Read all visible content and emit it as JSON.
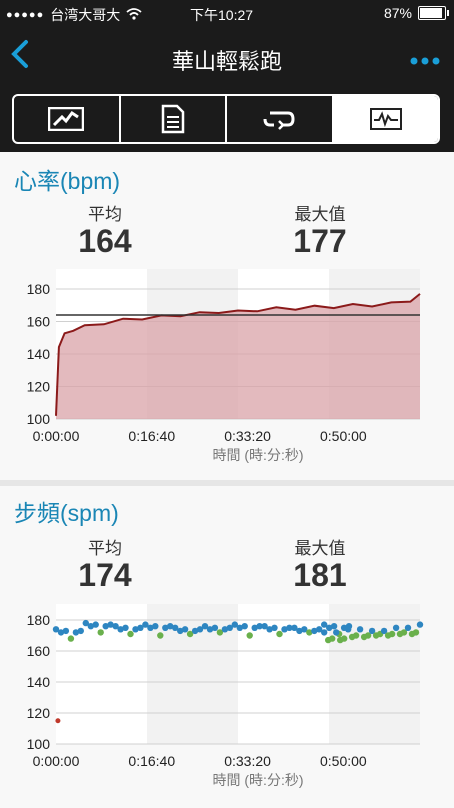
{
  "status": {
    "carrier": "台湾大哥大",
    "time": "下午10:27",
    "battery": "87%"
  },
  "nav": {
    "title": "華山輕鬆跑"
  },
  "tabs": [
    {
      "icon": "map-icon"
    },
    {
      "icon": "document-icon"
    },
    {
      "icon": "repeat-icon"
    },
    {
      "icon": "chart-icon",
      "selected": true
    }
  ],
  "hr": {
    "title": "心率(bpm)",
    "avg_label": "平均",
    "avg": "164",
    "max_label": "最大值",
    "max": "177"
  },
  "cad": {
    "title": "步頻(spm)",
    "avg_label": "平均",
    "avg": "174",
    "max_label": "最大值",
    "max": "181"
  },
  "colors": {
    "accent": "#1a86b5",
    "hr_line": "#8b1a1a",
    "hr_fill": "#d9a3a8",
    "cad_blue": "#2e86c1",
    "cad_green": "#6ab04c"
  },
  "chart_data": [
    {
      "type": "area",
      "xlabel": "時間 (時:分:秒)",
      "ylim": [
        100,
        180
      ],
      "yticks": [
        "100",
        "120",
        "140",
        "160",
        "180"
      ],
      "xticks": [
        "0:00:00",
        "0:16:40",
        "0:33:20",
        "0:50:00"
      ],
      "xlim": [
        0,
        3800
      ],
      "average": 164,
      "x": [
        0,
        30,
        90,
        180,
        300,
        500,
        700,
        900,
        1100,
        1300,
        1500,
        1700,
        1900,
        2100,
        2300,
        2500,
        2700,
        2900,
        3100,
        3300,
        3500,
        3700,
        3800
      ],
      "values": [
        102,
        145,
        152,
        155,
        157,
        159,
        161,
        162,
        163,
        164,
        165,
        166,
        166,
        167,
        168,
        168,
        169,
        169,
        170,
        170,
        171,
        173,
        177
      ]
    },
    {
      "type": "scatter",
      "xlabel": "時間 (時:分:秒)",
      "ylim": [
        100,
        180
      ],
      "yticks": [
        "100",
        "120",
        "140",
        "160",
        "180"
      ],
      "xticks": [
        "0:00:00",
        "0:16:40",
        "0:33:20",
        "0:50:00"
      ],
      "xlim": [
        0,
        3800
      ],
      "bands": [
        {
          "range": [
            0,
            2800
          ],
          "values_top": [
            174,
            178,
            176,
            177,
            175,
            176,
            177,
            176,
            175,
            177
          ],
          "values_bottom": [
            168,
            172,
            171,
            170,
            171,
            172,
            170,
            171,
            172,
            171
          ]
        },
        {
          "range": [
            2800,
            3800
          ],
          "values_top": [
            172,
            174,
            173,
            175,
            177
          ],
          "values_bottom": [
            166,
            168,
            169,
            170,
            171
          ]
        }
      ],
      "outliers": [
        {
          "x": 20,
          "y": 115
        }
      ]
    }
  ]
}
